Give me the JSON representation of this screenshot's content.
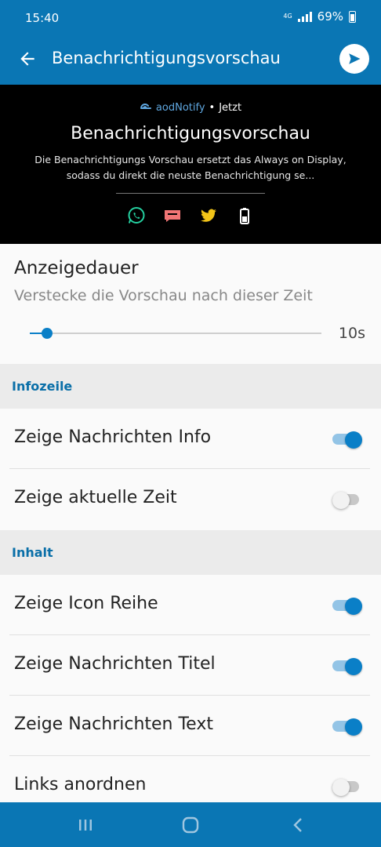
{
  "status_bar": {
    "time": "15:40",
    "network": "4G",
    "battery": "69%"
  },
  "app_bar": {
    "title": "Benachrichtigungsvorschau"
  },
  "preview": {
    "app_name": "aodNotify",
    "dot": "•",
    "time": "Jetzt",
    "title": "Benachrichtigungsvorschau",
    "text": "Die Benachrichtigungs Vorschau ersetzt das Always on Display, sodass du direkt die neuste Benachrichtigung se...",
    "icons": [
      "whatsapp-icon",
      "message-icon",
      "twitter-icon",
      "battery-icon"
    ]
  },
  "display_duration": {
    "title": "Anzeigedauer",
    "subtitle": "Verstecke die Vorschau nach dieser Zeit",
    "value_label": "10s",
    "slider_fraction": 0.06
  },
  "categories": {
    "info_line": "Infozeile",
    "content": "Inhalt"
  },
  "settings": [
    {
      "label": "Zeige Nachrichten Info",
      "on": true
    },
    {
      "label": "Zeige aktuelle Zeit",
      "on": false
    },
    {
      "label": "Zeige Icon Reihe",
      "on": true
    },
    {
      "label": "Zeige Nachrichten Titel",
      "on": true
    },
    {
      "label": "Zeige Nachrichten Text",
      "on": true
    },
    {
      "label": "Links anordnen",
      "on": false
    }
  ],
  "colors": {
    "primary": "#0a76b4",
    "accent": "#0a7fc7",
    "category_text": "#0a6fa8"
  }
}
